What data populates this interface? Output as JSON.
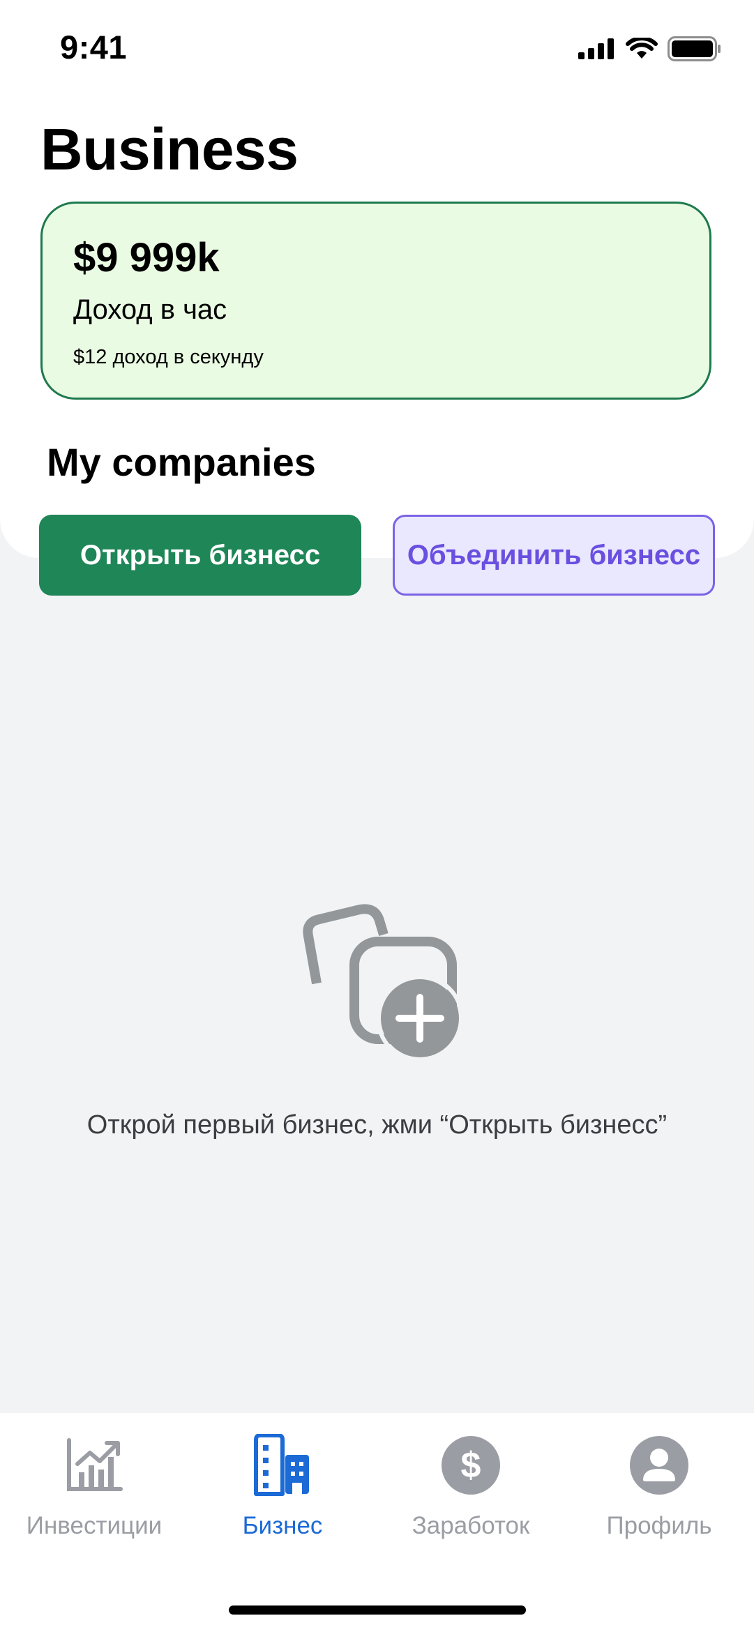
{
  "status_bar": {
    "time": "9:41"
  },
  "header": {
    "title": "Business"
  },
  "income_card": {
    "amount": "$9 999k",
    "label": "Доход в час",
    "per_second": "$12 доход в секунду"
  },
  "companies": {
    "title": "My companies",
    "open_button": "Открыть бизнесс",
    "merge_button": "Объединить бизнесс"
  },
  "empty_state": {
    "message": "Открой первый бизнес, жми “Открыть бизнесс”",
    "icon": "add-copy-icon"
  },
  "tabbar": {
    "items": [
      {
        "label": "Инвестиции",
        "icon": "chart-icon",
        "active": false
      },
      {
        "label": "Бизнес",
        "icon": "building-icon",
        "active": true
      },
      {
        "label": "Заработок",
        "icon": "dollar-icon",
        "active": false
      },
      {
        "label": "Профиль",
        "icon": "profile-icon",
        "active": false
      }
    ]
  },
  "colors": {
    "primary_green": "#1e8657",
    "card_bg": "#eafbe3",
    "purple": "#6a4fe0",
    "active_tab": "#1b6ad6",
    "inactive": "#9a9da3"
  }
}
